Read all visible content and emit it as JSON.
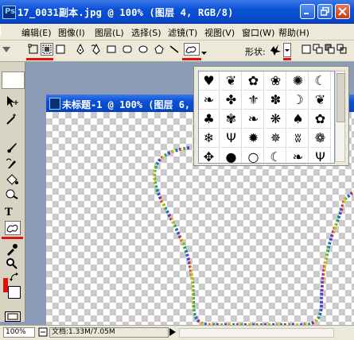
{
  "window": {
    "title": "17_0031副本.jpg @ 100% (图层 4, RGB/8)",
    "app_icon": "Ps"
  },
  "menu": [
    "编辑(E)",
    "图像(I)",
    "图层(L)",
    "选择(S)",
    "滤镜(T)",
    "视图(V)",
    "窗口(W)",
    "帮助(H)"
  ],
  "options": {
    "shape_label": "形状:"
  },
  "document": {
    "title": "未标题-1 @ 100% (图层 6,"
  },
  "status": {
    "zoom": "100%",
    "doc_info": "文档:1.33M/7.05M"
  },
  "toolbox": {
    "text_tool_label": "T"
  },
  "colors": {
    "accent_title": "#0a50d8",
    "highlight_red": "#e31010"
  },
  "shapes": [
    "bird",
    "grass",
    "leaf-splash",
    "flower",
    "sun-burst",
    "moon",
    "leaf",
    "maple-leaf",
    "fleur",
    "paw-print",
    "crescent",
    "leaf-2",
    "spruce",
    "daisy",
    "leaf-3",
    "butterfly",
    "tree",
    "flower-2",
    "snowflake",
    "grass-2",
    "star-burst",
    "pinwheel",
    "scribble",
    "flower-3",
    "ornament",
    "blob",
    "ring",
    "crescent-2",
    "leaf-4",
    "grass-3"
  ]
}
